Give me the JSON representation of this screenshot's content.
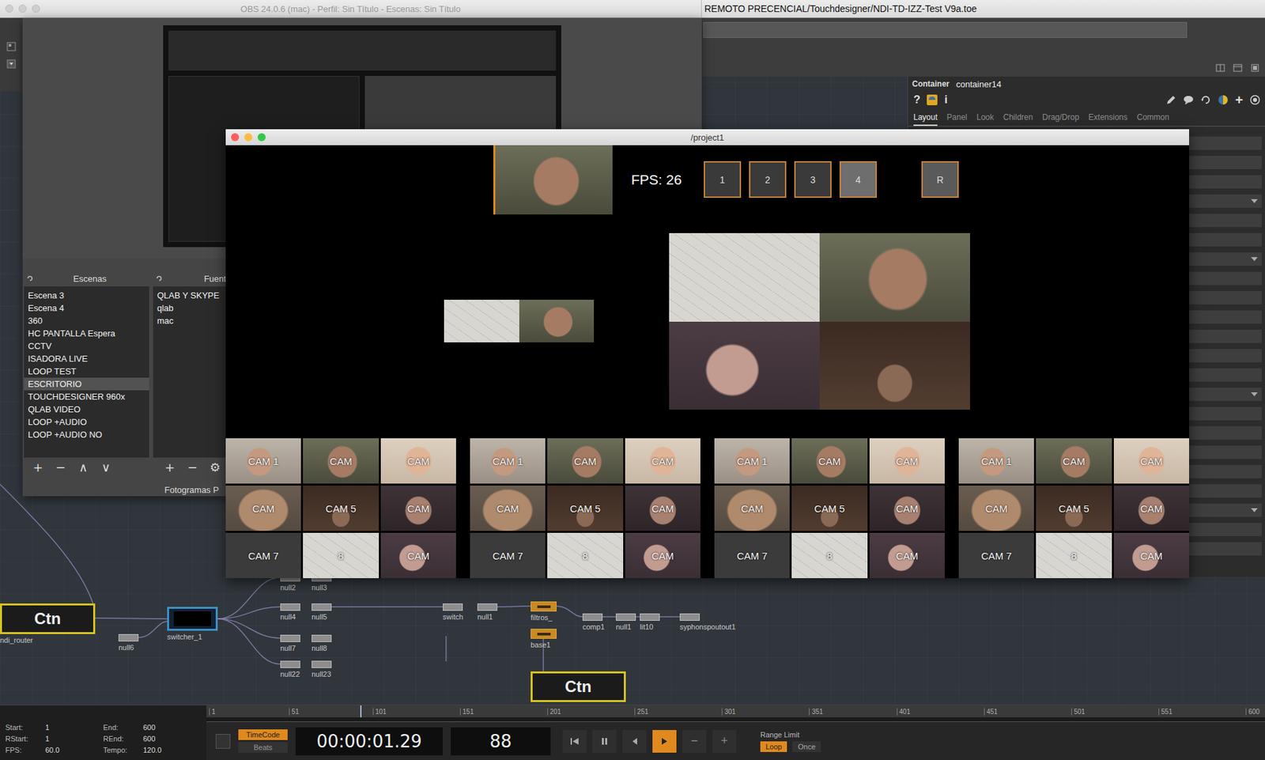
{
  "obs": {
    "title": "OBS 24.0.6 (mac) - Perfil: Sin Título - Escenas: Sin Título",
    "scenes": {
      "header": "Escenas",
      "items": [
        {
          "label": "Escena 3",
          "selected": false
        },
        {
          "label": "Escena 4",
          "selected": false
        },
        {
          "label": "360",
          "selected": false
        },
        {
          "label": "HC PANTALLA Espera",
          "selected": false
        },
        {
          "label": "CCTV",
          "selected": false
        },
        {
          "label": "ISADORA LIVE",
          "selected": false
        },
        {
          "label": "LOOP TEST",
          "selected": false
        },
        {
          "label": "ESCRITORIO",
          "selected": true
        },
        {
          "label": "TOUCHDESIGNER 960x",
          "selected": false
        },
        {
          "label": "QLAB VIDEO",
          "selected": false
        },
        {
          "label": "LOOP +AUDIO",
          "selected": false
        },
        {
          "label": "LOOP +AUDIO NO",
          "selected": false
        }
      ],
      "toolbar": [
        "+",
        "−",
        "∧",
        "∨"
      ]
    },
    "sources": {
      "header": "Fuent",
      "items": [
        "QLAB Y SKYPE",
        "qlab",
        "mac"
      ],
      "toolbar": [
        "+",
        "−",
        "⚙"
      ]
    },
    "status": "Fotogramas P"
  },
  "touchdesigner": {
    "title": "REMOTO PRECENCIAL/Touchdesigner/NDI-TD-IZZ-Test V9a.toe",
    "params": {
      "type": "Container",
      "name": "container14",
      "left_icons": [
        "?",
        "i"
      ],
      "add": "+",
      "tabs": [
        {
          "label": "Layout",
          "selected": true
        },
        {
          "label": "Panel",
          "selected": false
        },
        {
          "label": "Look",
          "selected": false
        },
        {
          "label": "Children",
          "selected": false
        },
        {
          "label": "Drag/Drop",
          "selected": false
        },
        {
          "label": "Extensions",
          "selected": false
        },
        {
          "label": "Common",
          "selected": false
        }
      ],
      "rows": [
        {
          "kind": "field"
        },
        {
          "kind": "field"
        },
        {
          "kind": "field"
        },
        {
          "kind": "menu"
        },
        {
          "kind": "field"
        },
        {
          "kind": "field"
        },
        {
          "kind": "menu"
        },
        {
          "kind": "field"
        },
        {
          "kind": "field"
        },
        {
          "kind": "field"
        },
        {
          "kind": "field"
        },
        {
          "kind": "field"
        },
        {
          "kind": "field"
        },
        {
          "kind": "menu"
        },
        {
          "kind": "field"
        },
        {
          "kind": "field"
        },
        {
          "kind": "field"
        },
        {
          "kind": "field"
        },
        {
          "kind": "field"
        },
        {
          "kind": "menu"
        },
        {
          "kind": "field"
        },
        {
          "kind": "field"
        }
      ]
    }
  },
  "project": {
    "title": "/project1",
    "fps": "FPS: 26",
    "buttons": [
      {
        "label": "1",
        "selected": false
      },
      {
        "label": "2",
        "selected": false
      },
      {
        "label": "3",
        "selected": false
      },
      {
        "label": "4",
        "selected": true
      }
    ],
    "reset": "R",
    "main_preview": {
      "kind": "man"
    },
    "mini_composite": [
      {
        "kind": "sketch"
      },
      {
        "kind": "man"
      }
    ],
    "big_grid": [
      {
        "kind": "sketch"
      },
      {
        "kind": "man"
      },
      {
        "kind": "mic"
      },
      {
        "kind": "room"
      }
    ],
    "cam_grids": [
      {
        "cells": [
          {
            "label": "CAM 1",
            "kind": "woman"
          },
          {
            "label": "CAM",
            "kind": "man"
          },
          {
            "label": "CAM",
            "kind": "woman-bright"
          },
          {
            "label": "CAM",
            "kind": "closeup"
          },
          {
            "label": "CAM 5",
            "kind": "room"
          },
          {
            "label": "CAM",
            "kind": "woman-dark"
          },
          {
            "label": "CAM 7",
            "kind": "blank"
          },
          {
            "label": "8",
            "kind": "sketch"
          },
          {
            "label": "CAM",
            "kind": "mic"
          }
        ]
      },
      {
        "cells": [
          {
            "label": "CAM 1",
            "kind": "woman"
          },
          {
            "label": "CAM",
            "kind": "man"
          },
          {
            "label": "CAM",
            "kind": "woman-bright"
          },
          {
            "label": "CAM",
            "kind": "closeup"
          },
          {
            "label": "CAM 5",
            "kind": "room"
          },
          {
            "label": "CAM",
            "kind": "woman-dark"
          },
          {
            "label": "CAM 7",
            "kind": "blank"
          },
          {
            "label": "8",
            "kind": "sketch"
          },
          {
            "label": "CAM",
            "kind": "mic"
          }
        ]
      },
      {
        "cells": [
          {
            "label": "CAM 1",
            "kind": "woman"
          },
          {
            "label": "CAM",
            "kind": "man"
          },
          {
            "label": "CAM",
            "kind": "woman-bright"
          },
          {
            "label": "CAM",
            "kind": "closeup"
          },
          {
            "label": "CAM 5",
            "kind": "room"
          },
          {
            "label": "CAM",
            "kind": "woman-dark"
          },
          {
            "label": "CAM 7",
            "kind": "blank"
          },
          {
            "label": "8",
            "kind": "sketch"
          },
          {
            "label": "CAM",
            "kind": "mic"
          }
        ]
      },
      {
        "cells": [
          {
            "label": "CAM 1",
            "kind": "woman"
          },
          {
            "label": "CAM",
            "kind": "man"
          },
          {
            "label": "CAM",
            "kind": "woman-bright"
          },
          {
            "label": "CAM",
            "kind": "closeup"
          },
          {
            "label": "CAM 5",
            "kind": "room"
          },
          {
            "label": "CAM",
            "kind": "woman-dark"
          },
          {
            "label": "CAM 7",
            "kind": "blank"
          },
          {
            "label": "8",
            "kind": "sketch"
          },
          {
            "label": "CAM",
            "kind": "mic"
          }
        ]
      }
    ]
  },
  "network": {
    "nodes": [
      {
        "label": "ndi_router",
        "kind": "comp",
        "text": "Ctn"
      },
      {
        "label": "null6",
        "kind": "null"
      },
      {
        "label": "switcher_1",
        "kind": "switch"
      },
      {
        "label": "null2",
        "kind": "null"
      },
      {
        "label": "null3",
        "kind": "null"
      },
      {
        "label": "null4",
        "kind": "null"
      },
      {
        "label": "null5",
        "kind": "null"
      },
      {
        "label": "null7",
        "kind": "null"
      },
      {
        "label": "null8",
        "kind": "null"
      },
      {
        "label": "null22",
        "kind": "null"
      },
      {
        "label": "null23",
        "kind": "null"
      },
      {
        "label": "switch",
        "kind": "null"
      },
      {
        "label": "null1",
        "kind": "null"
      },
      {
        "label": "filtros_",
        "kind": "filter"
      },
      {
        "label": "base1",
        "kind": "filter"
      },
      {
        "label": "comp1",
        "kind": "null"
      },
      {
        "label": "null1",
        "kind": "null"
      },
      {
        "label": "lit10",
        "kind": "null"
      },
      {
        "label": "syphonspoutout1",
        "kind": "null"
      },
      {
        "kind": "comp",
        "text": "Ctn"
      }
    ]
  },
  "timeline": {
    "info": [
      {
        "label": "Start:",
        "value": "1"
      },
      {
        "label": "End:",
        "value": "600"
      },
      {
        "label": "RStart:",
        "value": "1"
      },
      {
        "label": "REnd:",
        "value": "600"
      },
      {
        "label": "FPS:",
        "value": "60.0"
      },
      {
        "label": "Tempo:",
        "value": "120.0"
      }
    ],
    "ruler": [
      "1",
      "51",
      "101",
      "151",
      "201",
      "251",
      "301",
      "351",
      "401",
      "451",
      "501",
      "551",
      "600"
    ],
    "playhead": {
      "level": 0.145
    },
    "time_mode": [
      {
        "label": "TimeCode",
        "selected": true
      },
      {
        "label": "Beats",
        "selected": false
      }
    ],
    "timecode": "00:00:01.29",
    "frame": "88",
    "transport": [
      {
        "kind": "skip-start",
        "selected": false
      },
      {
        "kind": "pause",
        "selected": false
      },
      {
        "kind": "step-back",
        "selected": false
      },
      {
        "kind": "play",
        "selected": true
      },
      {
        "kind": "text",
        "label": "−",
        "selected": false
      },
      {
        "kind": "text",
        "label": "+",
        "selected": false
      }
    ],
    "range_limit": {
      "label": "Range Limit",
      "options": [
        {
          "label": "Loop",
          "selected": true
        },
        {
          "label": "Once",
          "selected": false
        }
      ]
    }
  }
}
